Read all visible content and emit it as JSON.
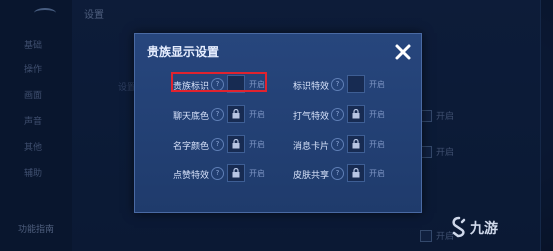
{
  "background": {
    "title": "设置",
    "sidebar_items": [
      "基础",
      "操作",
      "画面",
      "声音",
      "其他",
      "辅助",
      "功能指南"
    ],
    "mid_text": "设置",
    "right_rows": [
      "开启",
      "开启",
      "开启"
    ]
  },
  "modal": {
    "title": "贵族显示设置",
    "close_icon": "close-icon",
    "settings_left": [
      {
        "label": "贵族标识",
        "state": "开启",
        "locked": false
      },
      {
        "label": "聊天底色",
        "state": "开启",
        "locked": true
      },
      {
        "label": "名字颜色",
        "state": "开启",
        "locked": true
      },
      {
        "label": "点赞特效",
        "state": "开启",
        "locked": true
      }
    ],
    "settings_right": [
      {
        "label": "标识特效",
        "state": "开启",
        "locked": false
      },
      {
        "label": "打气特效",
        "state": "开启",
        "locked": true
      },
      {
        "label": "消息卡片",
        "state": "开启",
        "locked": true
      },
      {
        "label": "皮肤共享",
        "state": "开启",
        "locked": true
      }
    ],
    "help_glyph": "?"
  },
  "watermark": {
    "text": "九游"
  },
  "colors": {
    "highlight": "#e0232f",
    "modal_bg": "#23416f",
    "text": "#d7e2fa"
  }
}
